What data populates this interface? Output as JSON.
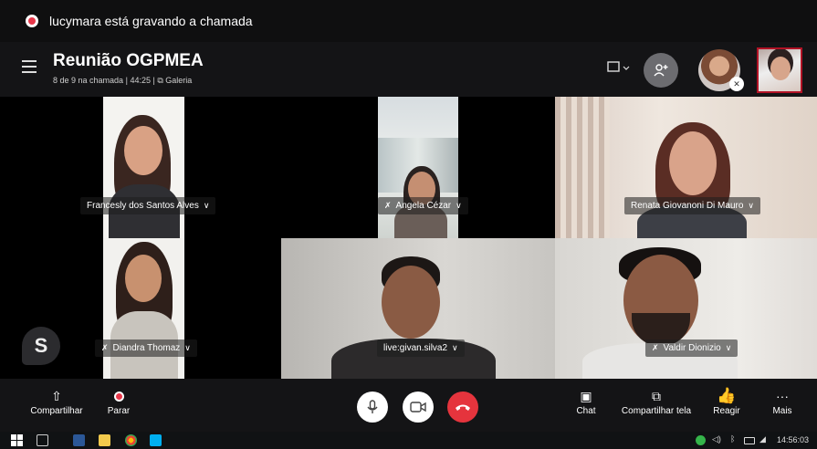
{
  "recording": {
    "text": "lucymara está gravando a chamada"
  },
  "header": {
    "title": "Reunião OGPMEA",
    "call_count": "8 de 9 na chamada",
    "duration": "44:25",
    "view_label": "Galeria",
    "separator": "|"
  },
  "participants": [
    {
      "name": "Francesly dos Santos Alves",
      "muted": false
    },
    {
      "name": "Angela Cézar",
      "muted": true
    },
    {
      "name": "Renata Giovanoni Di Mauro",
      "muted": false
    },
    {
      "name": "Diandra Thomaz",
      "muted": true
    },
    {
      "name": "live:givan.silva2",
      "muted": false
    },
    {
      "name": "Valdir Dionizio",
      "muted": true
    }
  ],
  "controls": {
    "share_label": "Compartilhar",
    "stop_label": "Parar",
    "chat_label": "Chat",
    "share_screen_label": "Compartilhar tela",
    "react_label": "Reagir",
    "more_label": "Mais"
  },
  "taskbar": {
    "time": "14:56:03"
  },
  "colors": {
    "end_call": "#e5343d",
    "recording": "#e8374a",
    "react": "#f5b521"
  }
}
